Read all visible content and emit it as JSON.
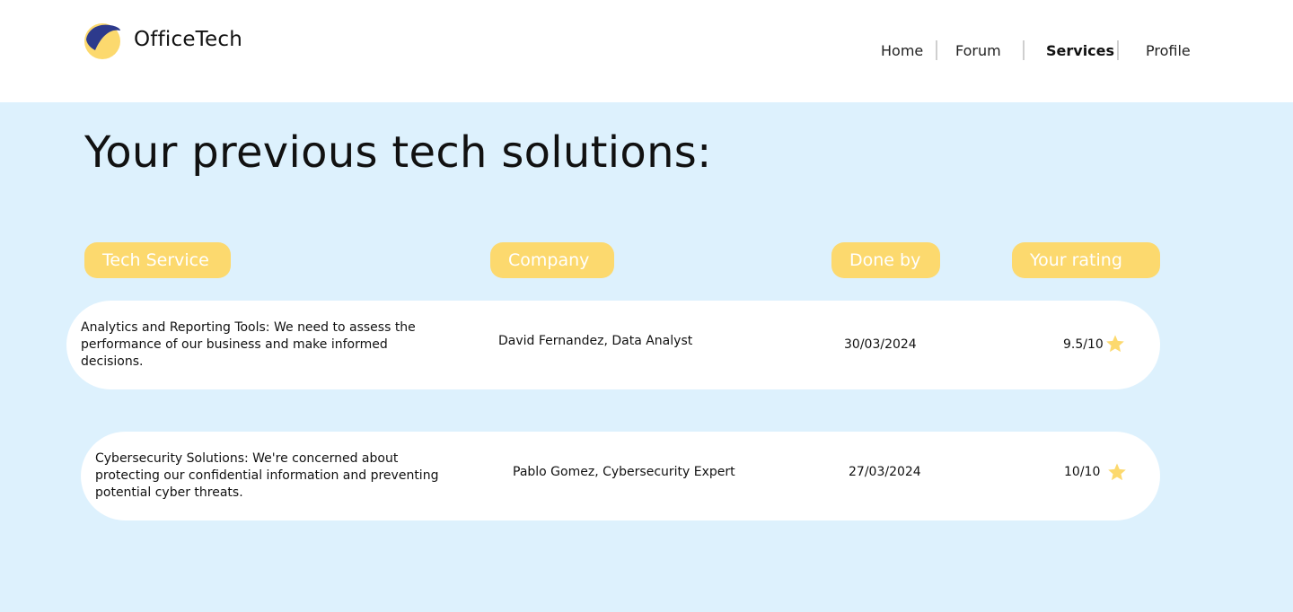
{
  "header": {
    "brand": "OfficeTech",
    "nav": [
      "Home",
      "Forum",
      "Services",
      "Profile"
    ],
    "active_nav": "Services"
  },
  "main": {
    "title": "Your previous tech solutions:",
    "columns": [
      "Tech Service",
      "Company",
      "Done by",
      "Your rating"
    ],
    "rows": [
      {
        "service": "Analytics and Reporting Tools: We need to assess the performance of our business and make informed decisions.",
        "company": "David Fernandez, Data Analyst",
        "date": "30/03/2024",
        "rating": "9.5/10"
      },
      {
        "service": "Cybersecurity Solutions: We're concerned about protecting our confidential information and preventing potential cyber threats.",
        "company": "Pablo Gomez, Cybersecurity Expert",
        "date": "27/03/2024",
        "rating": "10/10"
      }
    ]
  },
  "colors": {
    "accent_yellow": "#fcd96e",
    "logo_blue": "#2d3a8c",
    "background_light_blue": "#ddf1fd"
  },
  "icons": [
    "logo-icon",
    "star-icon"
  ]
}
